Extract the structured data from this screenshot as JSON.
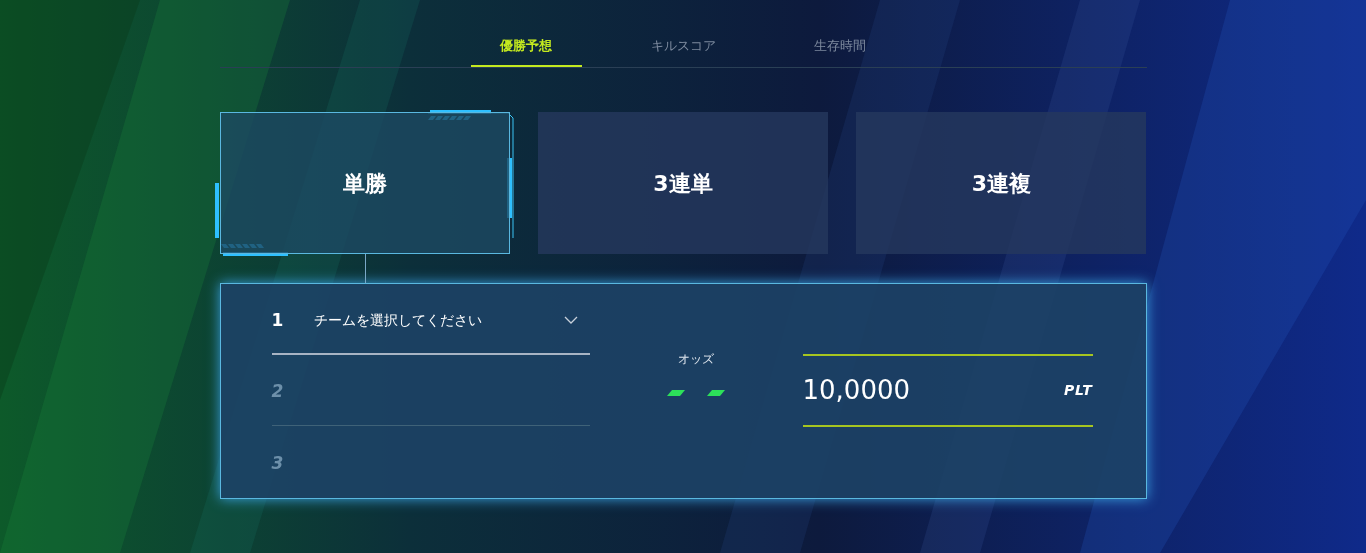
{
  "tabs": [
    {
      "label": "優勝予想",
      "selected": true
    },
    {
      "label": "キルスコア",
      "selected": false
    },
    {
      "label": "生存時間",
      "selected": false
    }
  ],
  "bet_types": [
    {
      "label": "単勝",
      "selected": true
    },
    {
      "label": "3連単",
      "selected": false
    },
    {
      "label": "3連複",
      "selected": false
    }
  ],
  "picks": [
    {
      "rank": "1",
      "disabled": false,
      "placeholder": "チームを選択してください"
    },
    {
      "rank": "2",
      "disabled": true
    },
    {
      "rank": "3",
      "disabled": true
    }
  ],
  "odds": {
    "label": "オッズ"
  },
  "amount": {
    "value": "10,0000",
    "unit": "PLT"
  }
}
